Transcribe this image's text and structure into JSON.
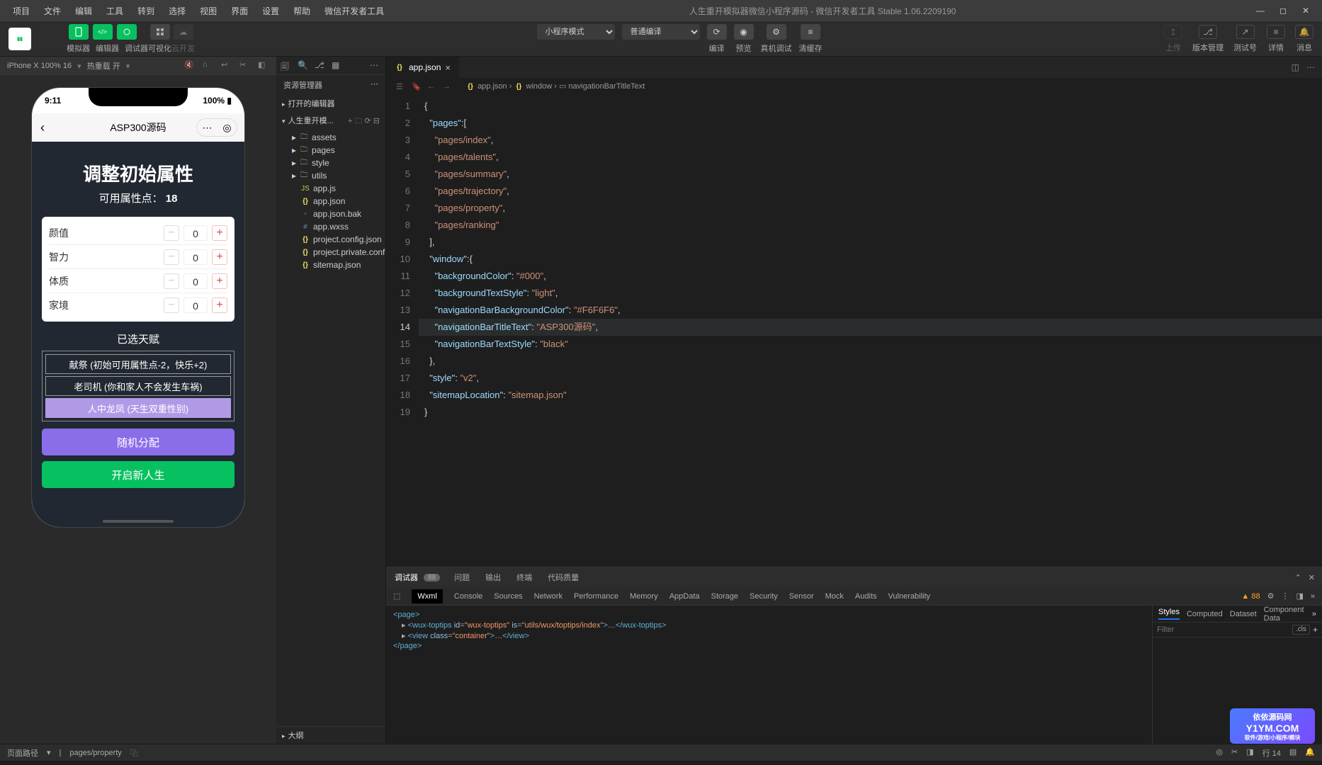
{
  "title": "人生重开模拟器微信小程序源码 - 微信开发者工具 Stable 1.06.2209190",
  "menu": [
    "项目",
    "文件",
    "编辑",
    "工具",
    "转到",
    "选择",
    "视图",
    "界面",
    "设置",
    "帮助",
    "微信开发者工具"
  ],
  "toolbar": {
    "groups": {
      "sim": "模拟器",
      "editor": "编辑器",
      "debug": "调试器",
      "visual": "可视化",
      "cloud": "云开发"
    },
    "mode": "小程序模式",
    "compile": "普通编译",
    "actions": {
      "compile_btn": "编译",
      "preview": "预览",
      "real": "真机调试",
      "clear": "清缓存"
    },
    "right": {
      "upload": "上传",
      "version": "版本管理",
      "test": "测试号",
      "detail": "详情",
      "msg": "消息"
    }
  },
  "simbar": {
    "device": "iPhone X 100% 16",
    "reload": "热重载 开"
  },
  "phone": {
    "time": "9:11",
    "battery": "100%",
    "title": "ASP300源码",
    "heading": "调整初始属性",
    "points_label": "可用属性点：",
    "points": "18",
    "props": [
      "颜值",
      "智力",
      "体质",
      "家境"
    ],
    "val": "0",
    "talent_title": "已选天赋",
    "talents": [
      "献祭 (初始可用属性点-2，快乐+2)",
      "老司机 (你和家人不会发生车祸)",
      "人中龙凤 (天生双重性别)"
    ],
    "random": "随机分配",
    "start": "开启新人生"
  },
  "explorer": {
    "title": "资源管理器",
    "open_editors": "打开的编辑器",
    "project": "人生重开模...",
    "folders": [
      "assets",
      "pages",
      "style",
      "utils"
    ],
    "files": [
      "app.js",
      "app.json",
      "app.json.bak",
      "app.wxss",
      "project.config.json",
      "project.private.config.js...",
      "sitemap.json"
    ],
    "outline": "大纲"
  },
  "tab": {
    "name": "app.json"
  },
  "breadcrumb": [
    "app.json",
    "window",
    "navigationBarTitleText"
  ],
  "code": {
    "lines": [
      "{",
      "  \"pages\":[",
      "    \"pages/index\",",
      "    \"pages/talents\",",
      "    \"pages/summary\",",
      "    \"pages/trajectory\",",
      "    \"pages/property\",",
      "    \"pages/ranking\"",
      "  ],",
      "  \"window\":{",
      "    \"backgroundColor\": \"#000\",",
      "    \"backgroundTextStyle\": \"light\",",
      "    \"navigationBarBackgroundColor\": \"#F6F6F6\",",
      "    \"navigationBarTitleText\": \"ASP300源码\",",
      "    \"navigationBarTextStyle\": \"black\"",
      "  },",
      "  \"style\": \"v2\",",
      "  \"sitemapLocation\": \"sitemap.json\"",
      "}"
    ]
  },
  "devtools": {
    "top": [
      "调试器",
      "问题",
      "输出",
      "终端",
      "代码质量"
    ],
    "badge": "88",
    "sub": [
      "Wxml",
      "Console",
      "Sources",
      "Network",
      "Performance",
      "Memory",
      "AppData",
      "Storage",
      "Security",
      "Sensor",
      "Mock",
      "Audits",
      "Vulnerability"
    ],
    "warn": "▲ 88",
    "dom": {
      "page_open": "<page>",
      "toptips": "<wux-toptips id=\"wux-toptips\" is=\"utils/wux/toptips/index\">…</wux-toptips>",
      "view": "<view class=\"container\">…</view>",
      "page_close": "</page>"
    },
    "styles": {
      "tabs": [
        "Styles",
        "Computed",
        "Dataset",
        "Component Data"
      ],
      "filter": "Filter",
      "cls": ".cls"
    }
  },
  "statusbar": {
    "path_label": "页面路径",
    "path": "pages/property",
    "pos": "行 14",
    "watermark1": "依依源码网",
    "watermark2": "Y1YM.COM",
    "watermark3": "软件/游戏/小程序/模块"
  }
}
